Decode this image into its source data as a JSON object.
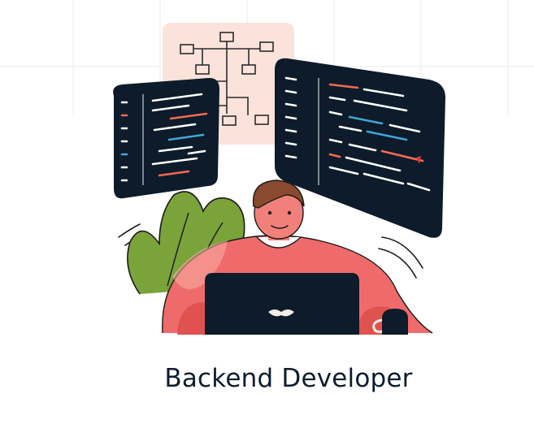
{
  "card": {
    "title": "Backend Developer"
  },
  "illustration": {
    "subject": "developer-at-laptop",
    "colors": {
      "screen_dark": "#0d1b2a",
      "shirt": "#ef6b6b",
      "shirt_dark": "#e0524f",
      "skin": "#f2807a",
      "hair": "#8a4a2e",
      "plant": "#7aa33a",
      "diagram_bg": "#fbe3dc",
      "code_white": "#ffffff",
      "code_orange": "#f26b4f",
      "code_blue": "#3fa7d6",
      "title_text": "#0f1d2e"
    }
  }
}
